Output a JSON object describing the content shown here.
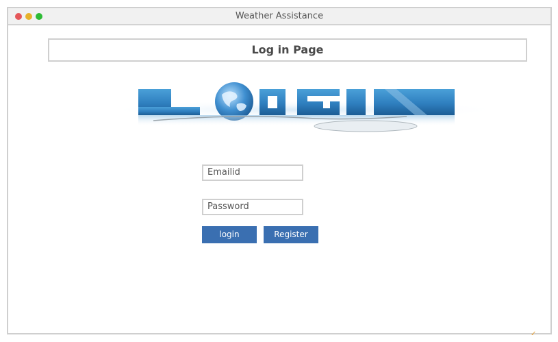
{
  "window": {
    "title": "Weather Assistance"
  },
  "page": {
    "header": "Log in Page"
  },
  "banner": {
    "text": "LOGIN"
  },
  "form": {
    "email_placeholder": "Emailid",
    "password_placeholder": "Password",
    "login_label": "login",
    "register_label": "Register"
  },
  "colors": {
    "button": "#3a6fb1",
    "banner_blue": "#2f7fbf",
    "dot_red": "#e5575a",
    "dot_yellow": "#e7b22b",
    "dot_green": "#2dbb35"
  }
}
